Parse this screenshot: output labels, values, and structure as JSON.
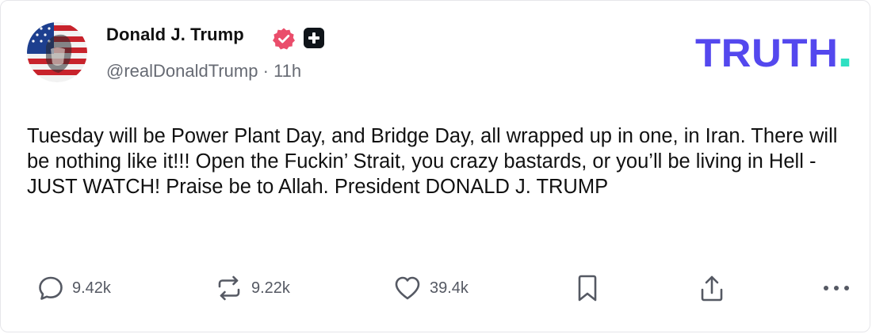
{
  "author": {
    "display_name": "Donald J. Trump",
    "handle": "@realDonaldTrump",
    "separator": "·",
    "time": "11h"
  },
  "brand": {
    "logo_text": "TRUTH",
    "primary_color": "#5448ee",
    "accent_color": "#2ee0c2"
  },
  "post": {
    "text": "Tuesday will be Power Plant Day, and Bridge Day, all wrapped up in one, in Iran. There will be nothing like it!!! Open the Fuckin’ Strait, you crazy bastards, or you’ll be living in Hell - JUST WATCH! Praise be to Allah. President DONALD J. TRUMP"
  },
  "actions": {
    "replies": "9.42k",
    "retruths": "9.22k",
    "likes": "39.4k"
  },
  "icons": {
    "verified": "verified-badge-icon",
    "plus": "plus-badge-icon",
    "reply": "reply-icon",
    "retruth": "retruth-icon",
    "like": "heart-icon",
    "bookmark": "bookmark-icon",
    "share": "share-icon",
    "more": "more-icon"
  }
}
